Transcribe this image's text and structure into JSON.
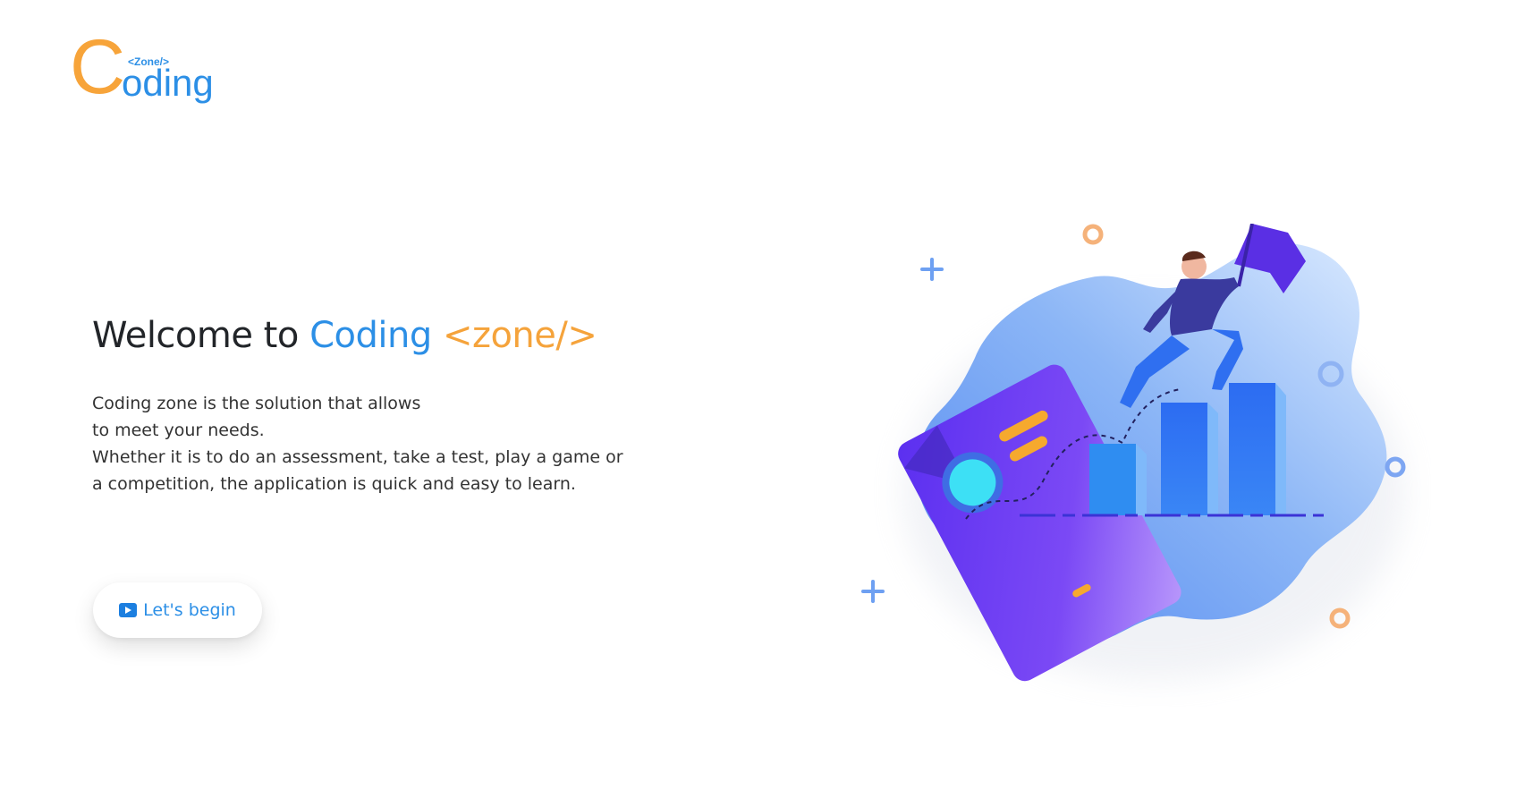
{
  "logo": {
    "c": "C",
    "zone": "<Zone/>",
    "oding": "oding"
  },
  "hero": {
    "title_prefix": "Welcome to ",
    "title_highlight_blue": "Coding",
    "title_highlight_orange": "<zone/>",
    "description_lines": [
      "Coding zone is the solution that allows",
      "to meet your needs.",
      "Whether it is to do an assessment, take a test, play a game or",
      "a competition, the application is quick and easy to learn."
    ],
    "button_label": "Let's begin",
    "button_icon": "play-icon"
  },
  "colors": {
    "brand_blue": "#2c8fe6",
    "brand_orange": "#f5a33b",
    "illustration_purple": "#6a3df0"
  }
}
